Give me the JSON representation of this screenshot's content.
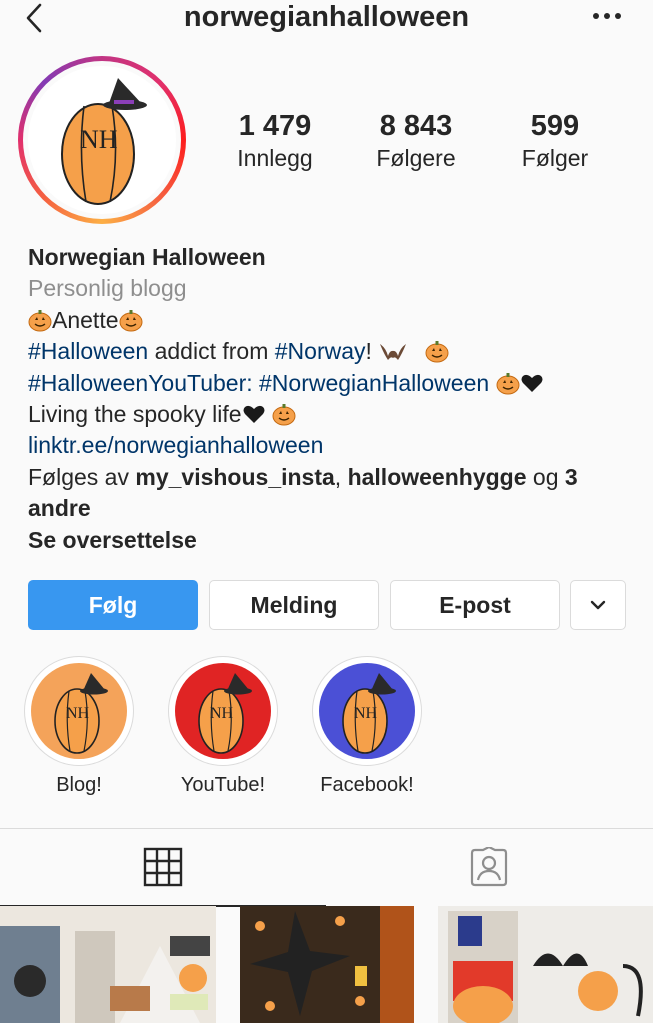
{
  "header": {
    "username": "norwegianhalloween",
    "back_icon": "chevron-left-icon",
    "more_icon": "more-horizontal-icon"
  },
  "profile": {
    "avatar_text": "Norwegian Halloween",
    "avatar_monogram": "NH",
    "stats": [
      {
        "value": "1 479",
        "label": "Innlegg"
      },
      {
        "value": "8 843",
        "label": "Følgere"
      },
      {
        "value": "599",
        "label": "Følger"
      }
    ]
  },
  "bio": {
    "name": "Norwegian Halloween",
    "category": "Personlig blogg",
    "line1_text": "Anette",
    "line2_tag1": "#Halloween",
    "line2_mid": " addict from ",
    "line2_tag2": "#Norway",
    "line2_end": "!",
    "line3_tag1": "#HalloweenYouTuber:",
    "line3_tag2": "#NorwegianHalloween",
    "line4_text": "Living the spooky life",
    "link": "linktr.ee/norwegianhalloween",
    "followed_prefix": "Følges av ",
    "followed_user1": "my_vishous_insta",
    "followed_comma": ", ",
    "followed_user2": "halloweenhygge",
    "followed_og": " og ",
    "followed_more": "3 andre",
    "translate": "Se oversettelse"
  },
  "actions": {
    "follow": "Følg",
    "message": "Melding",
    "email": "E-post",
    "dropdown_icon": "chevron-down-icon"
  },
  "highlights": [
    {
      "label": "Blog!",
      "color": "#f4a35a"
    },
    {
      "label": "YouTube!",
      "color": "#e02424"
    },
    {
      "label": "Facebook!",
      "color": "#4b50d6"
    }
  ],
  "tabs": {
    "grid_icon": "grid-icon",
    "tagged_icon": "tagged-person-icon"
  },
  "colors": {
    "accent": "#3897f0",
    "hashtag": "#003569",
    "muted": "#8e8e8e",
    "pumpkin": "#f5a04a"
  }
}
